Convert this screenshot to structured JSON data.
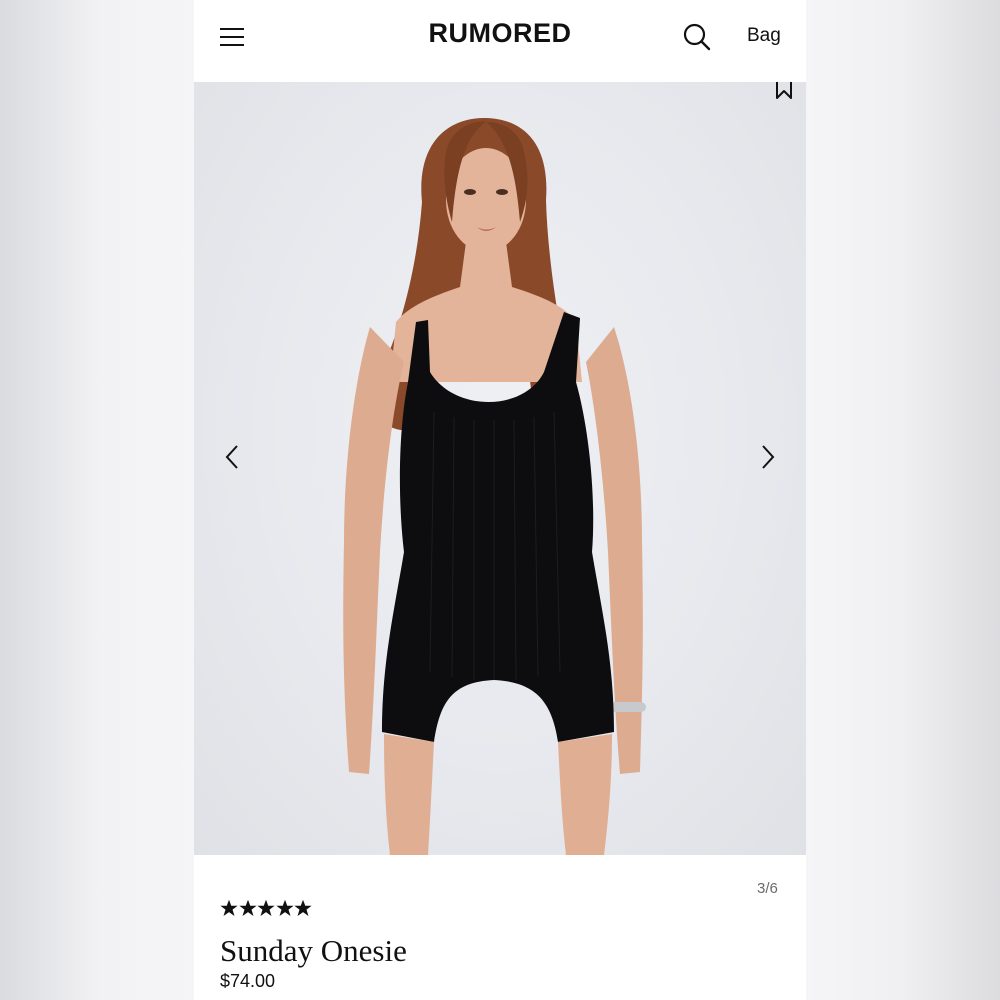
{
  "header": {
    "brand": "RUMORED",
    "bag_label": "Bag",
    "icons": [
      "menu-icon",
      "search-icon"
    ]
  },
  "gallery": {
    "counter": "3/6",
    "icons": [
      "bookmark-icon",
      "chevron-left-icon",
      "chevron-right-icon"
    ],
    "photo_description_colors": {
      "background": "#e7e9ee",
      "garment": "#0d0d0f",
      "hair": "#8a4a2a"
    }
  },
  "product": {
    "rating_stars": 5,
    "title": "Sunday Onesie",
    "price": "$74.00"
  },
  "colors": {
    "text": "#111111",
    "muted": "#6b6b6b",
    "surface": "#ffffff"
  }
}
